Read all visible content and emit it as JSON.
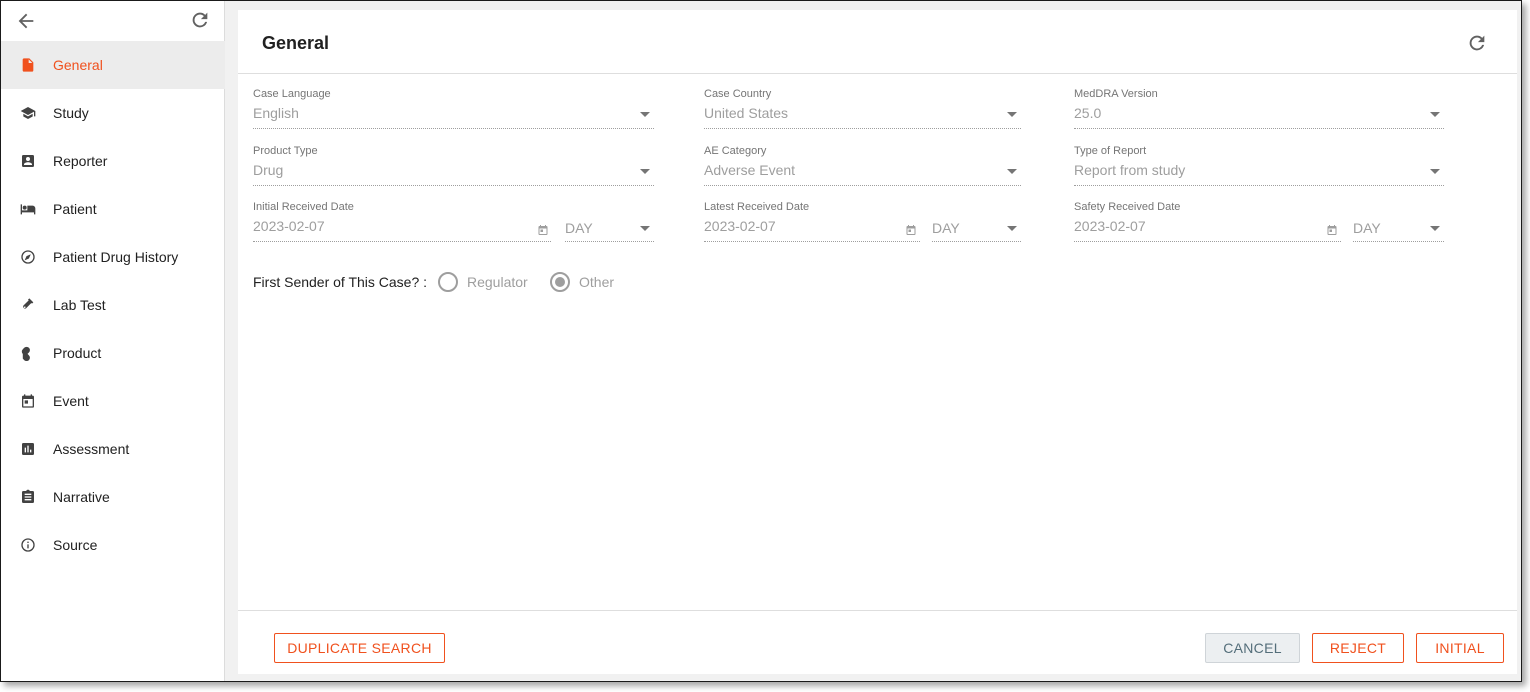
{
  "sidebar": {
    "items": [
      {
        "label": "General",
        "icon": "document-icon",
        "active": true
      },
      {
        "label": "Study",
        "icon": "graduation-cap-icon",
        "active": false
      },
      {
        "label": "Reporter",
        "icon": "contact-card-icon",
        "active": false
      },
      {
        "label": "Patient",
        "icon": "patient-bed-icon",
        "active": false
      },
      {
        "label": "Patient Drug History",
        "icon": "history-icon",
        "active": false
      },
      {
        "label": "Lab Test",
        "icon": "test-tube-icon",
        "active": false
      },
      {
        "label": "Product",
        "icon": "pill-icon",
        "active": false
      },
      {
        "label": "Event",
        "icon": "calendar-icon",
        "active": false
      },
      {
        "label": "Assessment",
        "icon": "bar-chart-icon",
        "active": false
      },
      {
        "label": "Narrative",
        "icon": "clipboard-icon",
        "active": false
      },
      {
        "label": "Source",
        "icon": "info-icon",
        "active": false
      }
    ]
  },
  "main": {
    "title": "General",
    "fields": {
      "case_language": {
        "label": "Case Language",
        "value": "English"
      },
      "case_country": {
        "label": "Case Country",
        "value": "United States"
      },
      "meddra_version": {
        "label": "MedDRA Version",
        "value": "25.0"
      },
      "product_type": {
        "label": "Product Type",
        "value": "Drug"
      },
      "ae_category": {
        "label": "AE Category",
        "value": "Adverse Event"
      },
      "type_of_report": {
        "label": "Type of Report",
        "value": "Report from study"
      },
      "initial_received_date": {
        "label": "Initial Received Date",
        "value": "2023-02-07",
        "precision": "DAY"
      },
      "latest_received_date": {
        "label": "Latest Received Date",
        "value": "2023-02-07",
        "precision": "DAY"
      },
      "safety_received_date": {
        "label": "Safety Received Date",
        "value": "2023-02-07",
        "precision": "DAY"
      }
    },
    "first_sender": {
      "label": "First Sender of This Case?  :",
      "options": [
        "Regulator",
        "Other"
      ],
      "selected": "Other"
    }
  },
  "footer": {
    "duplicate_search": "DUPLICATE SEARCH",
    "cancel": "CANCEL",
    "reject": "REJECT",
    "initial": "INITIAL"
  },
  "colors": {
    "accent": "#f0511e",
    "muted_text": "#9e9e9e",
    "active_bg": "#ececec"
  }
}
